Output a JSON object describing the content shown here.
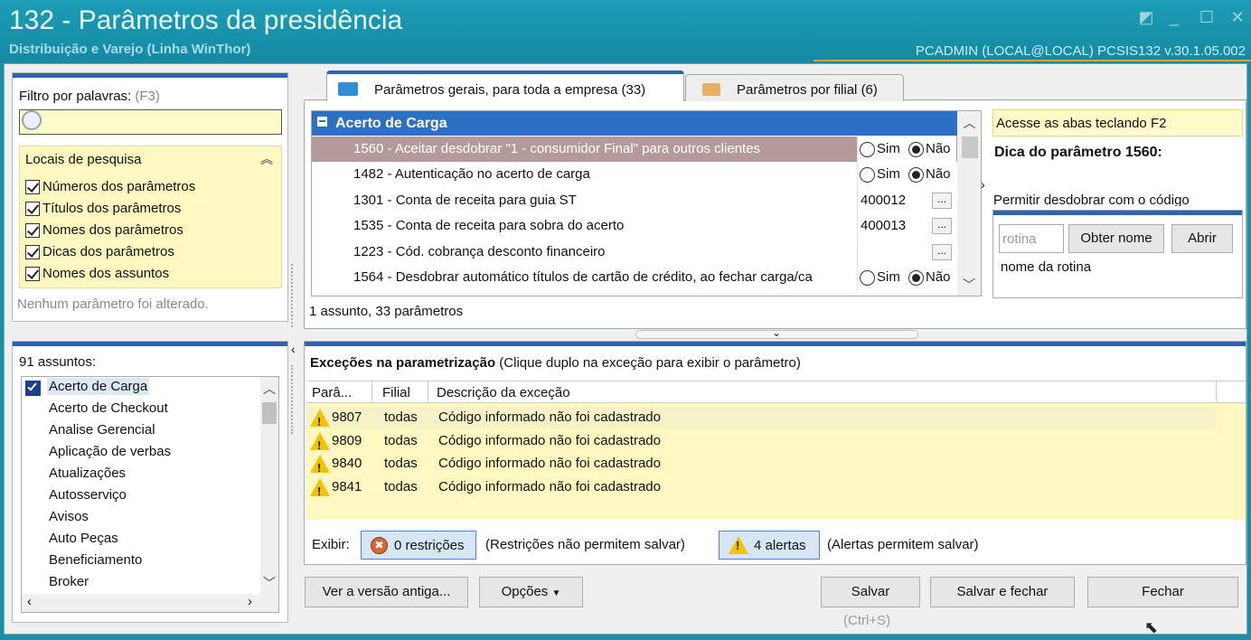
{
  "window": {
    "title": "132 - Parâmetros da presidência",
    "subtitle": "Distribuição e Varejo (Linha WinThor)",
    "user_info": "PCADMIN (LOCAL@LOCAL)   PCSIS132  v.30.1.05.002"
  },
  "filter": {
    "label": "Filtro por palavras:",
    "shortcut": "(F3)",
    "value": "",
    "locations_title": "Locais de pesquisa",
    "options": [
      "Números dos parâmetros",
      "Títulos dos parâmetros",
      "Nomes dos parâmetros",
      "Dicas dos parâmetros",
      "Nomes dos assuntos"
    ],
    "status": "Nenhum parâmetro foi alterado."
  },
  "subjects": {
    "count_label": "91 assuntos:",
    "items": [
      "Acerto de Carga",
      "Acerto de Checkout",
      "Analise Gerencial",
      "Aplicação de verbas",
      "Atualizações",
      "Autosserviço",
      "Avisos",
      "Auto Peças",
      "Beneficiamento",
      "Broker"
    ]
  },
  "tabs": [
    {
      "label": "Parâmetros gerais, para toda a empresa",
      "count": "(33)"
    },
    {
      "label": "Parâmetros por filial",
      "count": "(6)"
    }
  ],
  "params": {
    "group": "Acerto de Carga",
    "rows": [
      {
        "label": "1560 - Aceitar desdobrar \"1 - consumidor Final\" para outros clientes",
        "value": "radio"
      },
      {
        "label": "1482 - Autenticação no acerto de carga",
        "value": "radio"
      },
      {
        "label": "1301 - Conta de receita para guia ST",
        "value": "400012"
      },
      {
        "label": "1535 - Conta de receita para sobra do acerto",
        "value": "400013"
      },
      {
        "label": "1223 - Cód. cobrança desconto financeiro",
        "value": ""
      },
      {
        "label": "1564 - Desdobrar automático títulos de cartão de crédito, ao fechar carga/ca",
        "value": "radio"
      }
    ],
    "sim": "Sim",
    "nao": "Não",
    "ellipsis": "...",
    "footer": "1 assunto, 33 parâmetros"
  },
  "hint": {
    "banner": "Acesse as abas teclando F2",
    "title": "Dica do parâmetro 1560:",
    "text": "Permitir desdobrar com o código",
    "rotina_placeholder": "rotina",
    "get_name": "Obter nome",
    "open": "Abrir",
    "rotina_name": "nome da rotina"
  },
  "exceptions": {
    "title": "Exceções na parametrização",
    "subtitle": "(Clique duplo na exceção para exibir o parâmetro)",
    "columns": [
      "Parâ...",
      "Filial",
      "Descrição da exceção"
    ],
    "rows": [
      {
        "param": "9807",
        "filial": "todas",
        "desc": "Código informado não foi cadastrado"
      },
      {
        "param": "9809",
        "filial": "todas",
        "desc": "Código informado não foi cadastrado"
      },
      {
        "param": "9840",
        "filial": "todas",
        "desc": "Código informado não foi cadastrado"
      },
      {
        "param": "9841",
        "filial": "todas",
        "desc": "Código informado não foi cadastrado"
      }
    ],
    "show_label": "Exibir:",
    "restrictions_btn": "0 restrições",
    "restrictions_note": "(Restrições não permitem salvar)",
    "alerts_btn": "4 alertas",
    "alerts_note": "(Alertas permitem salvar)"
  },
  "footer": {
    "old_version": "Ver a versão antiga...",
    "options": "Opções",
    "save": "Salvar",
    "save_shortcut": "(Ctrl+S)",
    "save_close": "Salvar e fechar",
    "close": "Fechar"
  },
  "colors": {
    "accent": "#2d63b0",
    "titlebar": "#1a8fa6",
    "highlight_yellow": "#fdf8c0",
    "selected_row": "#b49a9a"
  }
}
